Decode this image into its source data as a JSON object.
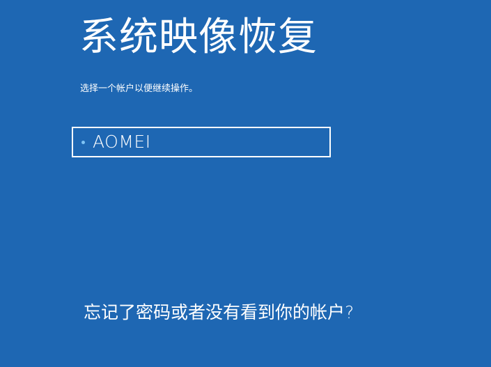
{
  "page": {
    "title": "系统映像恢复",
    "subtitle": "选择一个帐户以便继续操作。"
  },
  "accounts": [
    {
      "name": "AOMEI"
    }
  ],
  "links": {
    "forgot": "忘记了密码或者没有看到你的帐户?"
  },
  "colors": {
    "background": "#1e67b3",
    "text": "#ffffff",
    "bullet": "#7fc4f5"
  }
}
